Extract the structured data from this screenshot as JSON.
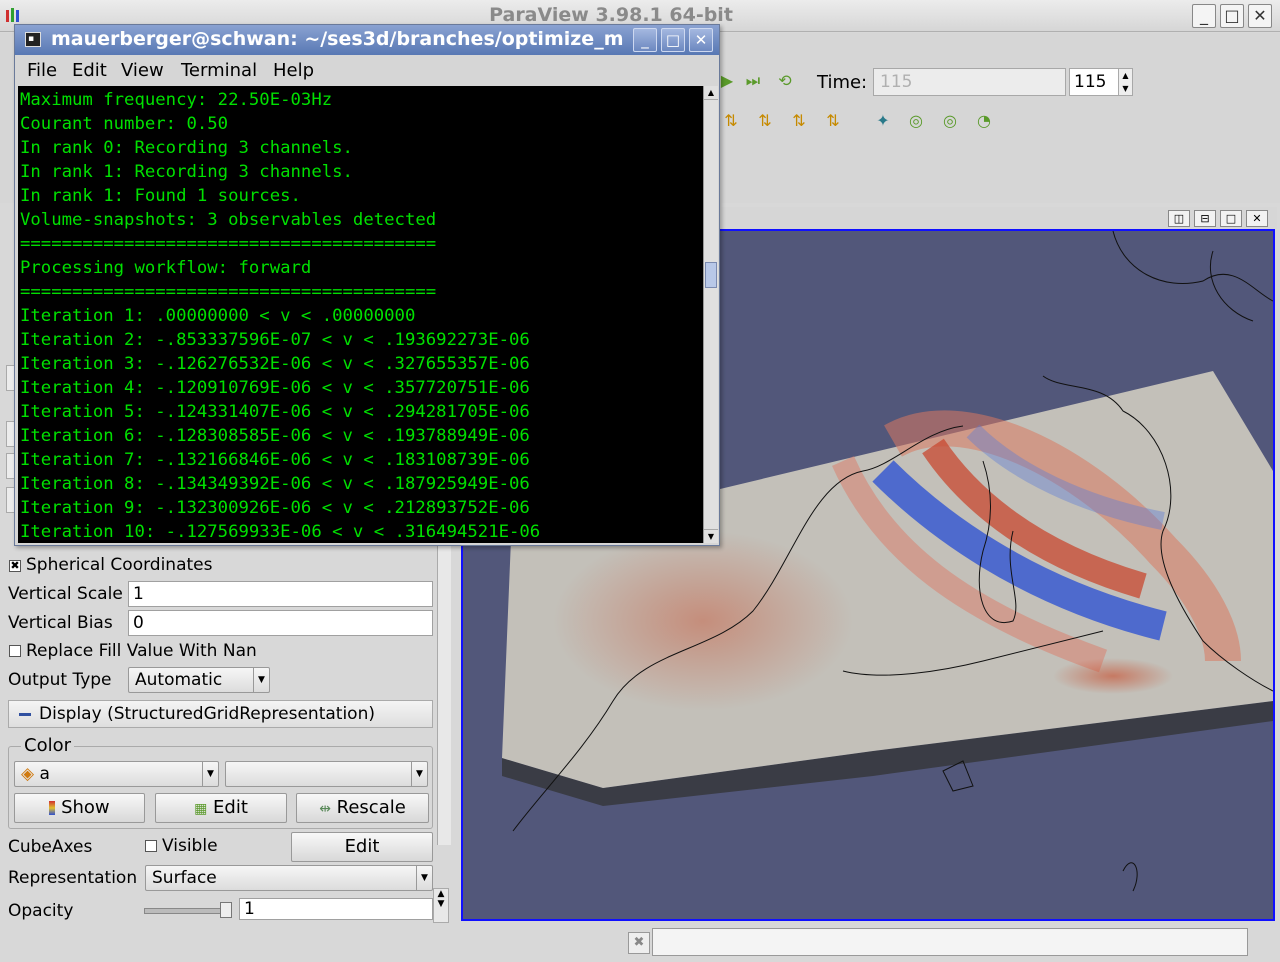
{
  "paraview": {
    "window_title": "ParaView 3.98.1 64-bit",
    "time_label": "Time:",
    "time_field_value": "115",
    "time_spin_value": "115"
  },
  "terminal": {
    "title": "mauerberger@schwan: ~/ses3d/branches/optimize_m",
    "menus": [
      "File",
      "Edit",
      "View",
      "Terminal",
      "Help"
    ],
    "lines": [
      "Maximum frequency: 22.50E-03Hz",
      "Courant number: 0.50",
      "In rank 0: Recording 3 channels.",
      "In rank 1: Recording 3 channels.",
      "In rank 1: Found 1 sources.",
      "Volume-snapshots: 3 observables detected",
      "========================================",
      "Processing workflow: forward",
      "========================================",
      "Iteration 1: .00000000 < v < .00000000",
      "Iteration 2: -.853337596E-07 < v < .193692273E-06",
      "Iteration 3: -.126276532E-06 < v < .327655357E-06",
      "Iteration 4: -.120910769E-06 < v < .357720751E-06",
      "Iteration 5: -.124331407E-06 < v < .294281705E-06",
      "Iteration 6: -.128308585E-06 < v < .193788949E-06",
      "Iteration 7: -.132166846E-06 < v < .183108739E-06",
      "Iteration 8: -.134349392E-06 < v < .187925949E-06",
      "Iteration 9: -.132300926E-06 < v < .212893752E-06",
      "Iteration 10: -.127569933E-06 < v < .316494521E-06"
    ]
  },
  "properties": {
    "spherical_coordinates": {
      "label": "Spherical Coordinates",
      "checked": true
    },
    "vertical_scale": {
      "label": "Vertical Scale",
      "value": "1"
    },
    "vertical_bias": {
      "label": "Vertical Bias",
      "value": "0"
    },
    "replace_fill": {
      "label": "Replace Fill Value With Nan",
      "checked": false
    },
    "output_type": {
      "label": "Output Type",
      "value": "Automatic"
    },
    "display_header": "Display (StructuredGridRepresentation)",
    "color_group_title": "Color",
    "color_array": "a",
    "color_component": "",
    "show_button": "Show",
    "edit_button": "Edit",
    "rescale_button": "Rescale",
    "cube_axes_label": "CubeAxes",
    "cube_axes_visible": "Visible",
    "cube_axes_edit": "Edit",
    "representation": {
      "label": "Representation",
      "value": "Surface"
    },
    "opacity": {
      "label": "Opacity",
      "value": "1"
    }
  },
  "colors": {
    "terminal_text": "#00e000",
    "terminal_bg": "#000000",
    "render_bg": "#52577a",
    "view_border": "#1010ff"
  }
}
